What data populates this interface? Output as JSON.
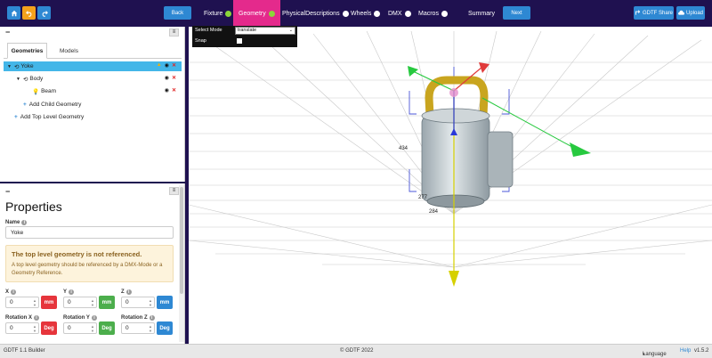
{
  "header": {
    "home_icon": "home-icon",
    "undo_icon": "undo-icon",
    "redo_icon": "redo-icon",
    "back_label": "Back",
    "next_label": "Next",
    "share_label": "GDTF Share",
    "upload_label": "Upload",
    "steps": [
      {
        "label": "Fixture",
        "status": "done"
      },
      {
        "label": "Geometry",
        "status": "active"
      },
      {
        "label": "PhysicalDescriptions",
        "status": "todo"
      },
      {
        "label": "Wheels",
        "status": "todo"
      },
      {
        "label": "DMX",
        "status": "todo"
      },
      {
        "label": "Macros",
        "status": "todo"
      },
      {
        "label": "Summary",
        "status": "none"
      }
    ]
  },
  "tree_panel": {
    "collapse_label": "−",
    "tabs": [
      "Geometries",
      "Models"
    ],
    "nodes": [
      {
        "label": "Yoke",
        "selected": true
      },
      {
        "label": "Body",
        "selected": false
      },
      {
        "label": "Beam",
        "selected": false
      }
    ],
    "add_child_label": "Add Child Geometry",
    "add_top_label": "Add Top Level Geometry"
  },
  "properties": {
    "collapse_label": "−",
    "title": "Properties",
    "name_label": "Name",
    "name_value": "Yoke",
    "alert_title": "The top level geometry is not referenced.",
    "alert_body": "A top level geometry should be referenced by a DMX-Mode or a Geometry Reference.",
    "x_label": "X",
    "y_label": "Y",
    "z_label": "Z",
    "x_value": "0",
    "y_value": "0",
    "z_value": "0",
    "mm_label": "mm",
    "rx_label": "Rotation X",
    "ry_label": "Rotation Y",
    "rz_label": "Rotation Z",
    "rx_value": "0",
    "ry_value": "0",
    "rz_value": "0",
    "deg_label": "Deg"
  },
  "viewport": {
    "select_mode_label": "Select Mode",
    "select_mode_value": "translate",
    "snap_label": "Snap",
    "dim_labels": [
      "434",
      "277",
      "284"
    ]
  },
  "footer": {
    "builder": "GDTF 1.1 Builder",
    "copyright": "© GDTF 2022",
    "language": "Language",
    "help": "Help",
    "version": "v1.5.2"
  },
  "colors": {
    "header_bg": "#1f1150",
    "accent_blue": "#2e88d3",
    "active_step": "#e42a8c",
    "selected_row": "#43b6e8"
  }
}
